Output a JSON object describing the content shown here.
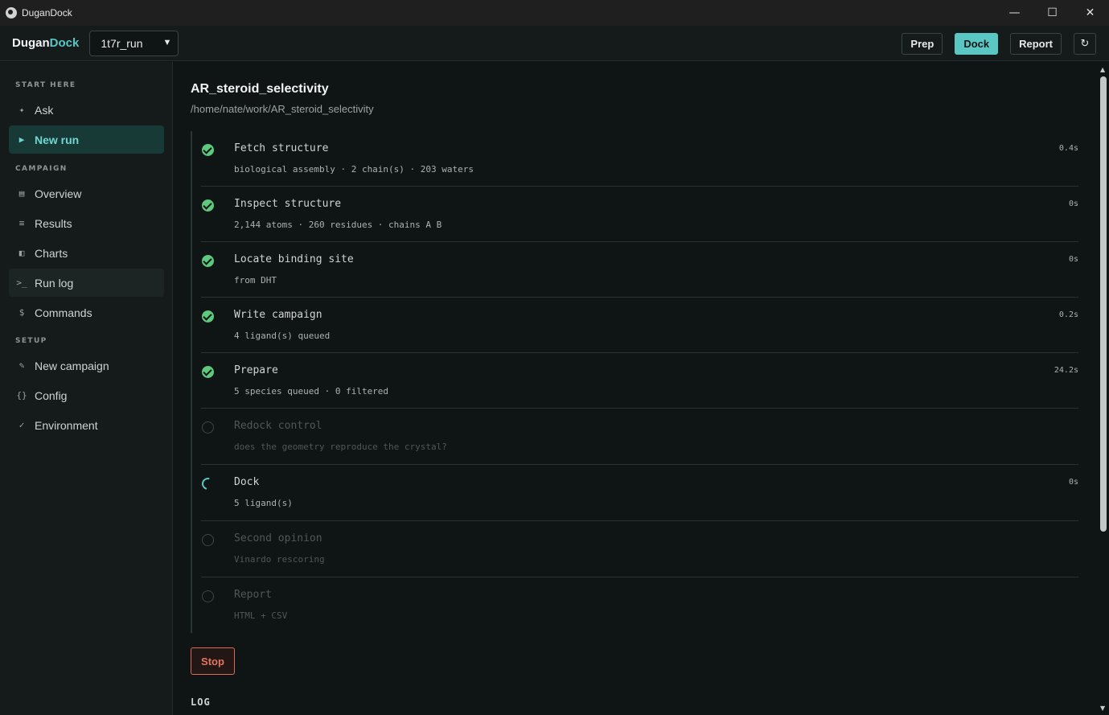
{
  "window": {
    "title": "DuganDock"
  },
  "brand": {
    "part1": "Dugan",
    "part2": "Dock"
  },
  "run_select": {
    "value": "1t7r_run"
  },
  "top_actions": {
    "prep": "Prep",
    "dock": "Dock",
    "report": "Report",
    "refresh": "↻"
  },
  "sidebar": {
    "start_label": "START HERE",
    "campaign_label": "CAMPAIGN",
    "setup_label": "SETUP",
    "items": [
      {
        "label": "Ask",
        "icon": "✦"
      },
      {
        "label": "New run",
        "icon": "▶"
      },
      {
        "label": "Overview",
        "icon": "▤"
      },
      {
        "label": "Results",
        "icon": "≡"
      },
      {
        "label": "Charts",
        "icon": "◧"
      },
      {
        "label": "Run log",
        "icon": ">_"
      },
      {
        "label": "Commands",
        "icon": "$"
      },
      {
        "label": "New campaign",
        "icon": "✎"
      },
      {
        "label": "Config",
        "icon": "{}"
      },
      {
        "label": "Environment",
        "icon": "✓"
      }
    ]
  },
  "main": {
    "title": "AR_steroid_selectivity",
    "path": "/home/nate/work/AR_steroid_selectivity",
    "steps": [
      {
        "name": "Fetch structure",
        "detail": "biological assembly · 2 chain(s) · 203 waters",
        "time": "0.4s",
        "status": "done"
      },
      {
        "name": "Inspect structure",
        "detail": "2,144 atoms · 260 residues · chains A B",
        "time": "0s",
        "status": "done"
      },
      {
        "name": "Locate binding site",
        "detail": "from DHT",
        "time": "0s",
        "status": "done"
      },
      {
        "name": "Write campaign",
        "detail": "4 ligand(s) queued",
        "time": "0.2s",
        "status": "done"
      },
      {
        "name": "Prepare",
        "detail": "5 species queued · 0 filtered",
        "time": "24.2s",
        "status": "done"
      },
      {
        "name": "Redock control",
        "detail": "does the geometry reproduce the crystal?",
        "time": "",
        "status": "pending"
      },
      {
        "name": "Dock",
        "detail": "5 ligand(s)",
        "time": "0s",
        "status": "running"
      },
      {
        "name": "Second opinion",
        "detail": "Vinardo rescoring",
        "time": "",
        "status": "pending"
      },
      {
        "name": "Report",
        "detail": "HTML + CSV",
        "time": "",
        "status": "pending"
      }
    ],
    "stop_label": "Stop",
    "log_label": "LOG"
  }
}
